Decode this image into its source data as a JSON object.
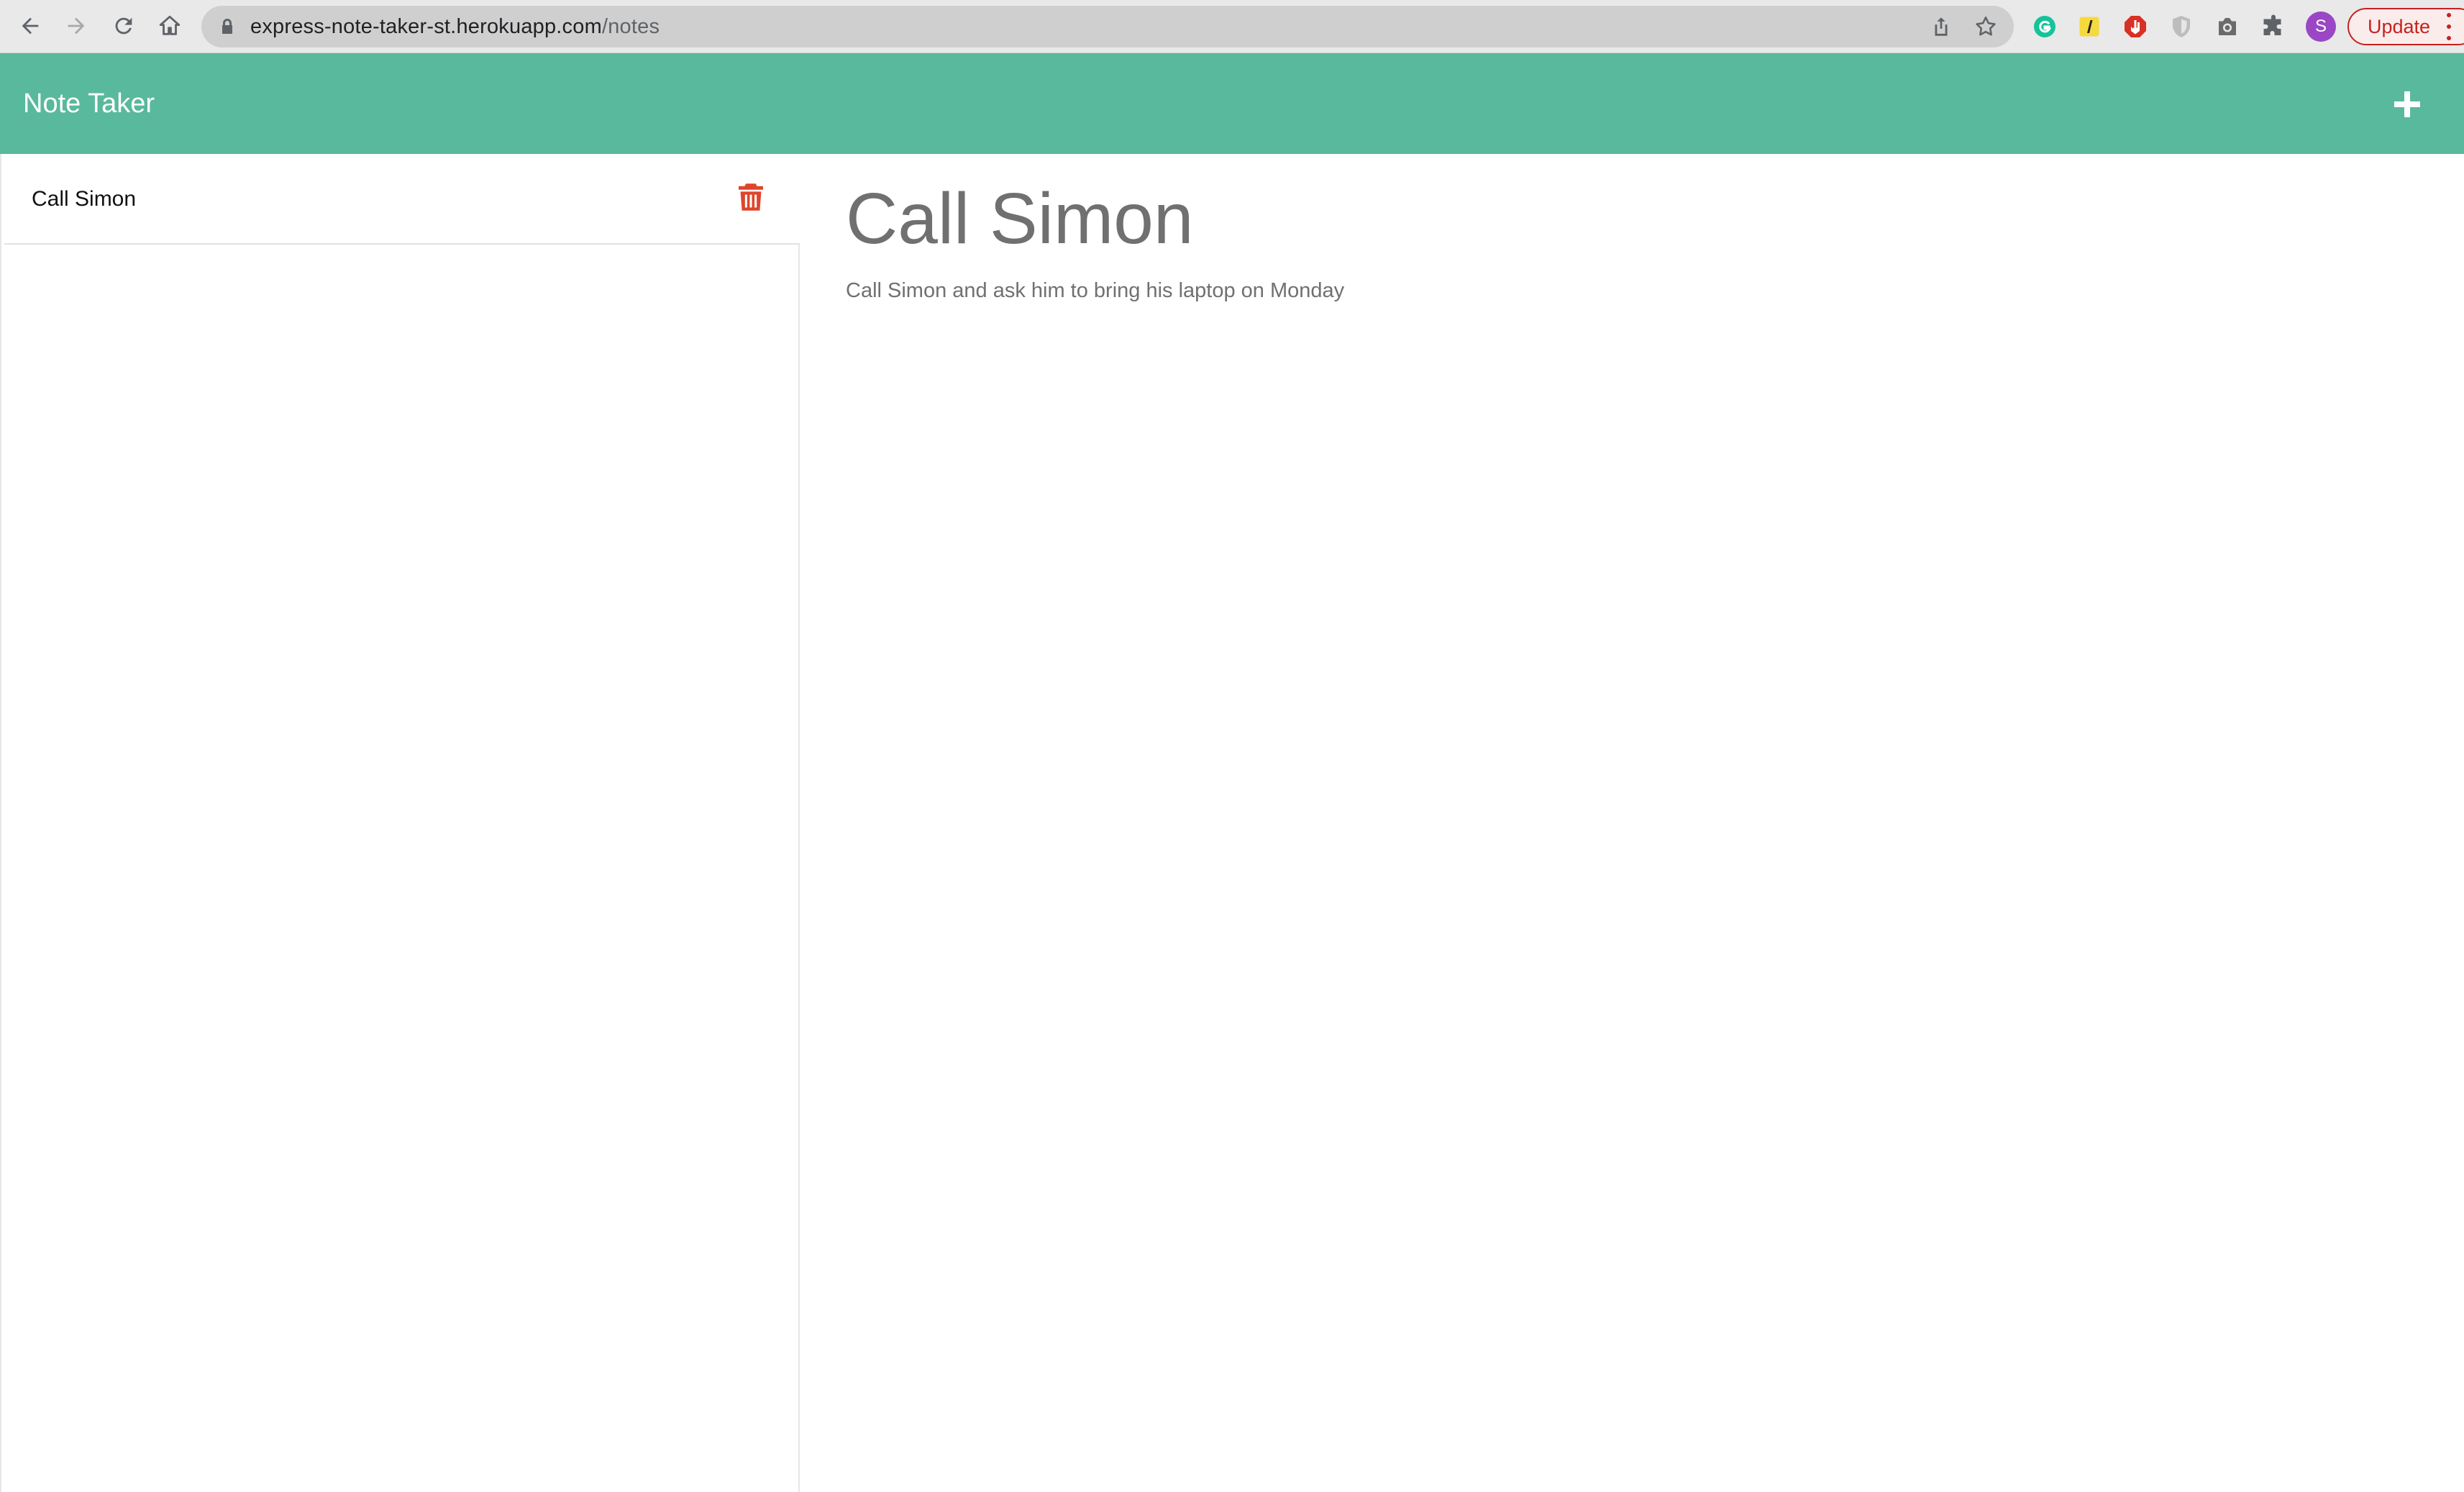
{
  "browser": {
    "url_host": "express-note-taker-st.herokuapp.com",
    "url_path": "/notes",
    "profile_initial": "S",
    "update_label": "Update",
    "icons": {
      "back": "back-arrow-icon",
      "forward": "forward-arrow-icon",
      "reload": "reload-icon",
      "home": "home-icon",
      "share": "share-icon",
      "bookmark": "star-icon",
      "extensions": [
        "grammarly-icon",
        "extension-yellow-icon",
        "adblock-icon",
        "shield-icon",
        "camera-icon",
        "puzzle-icon"
      ]
    }
  },
  "app": {
    "brand": "Note Taker",
    "new_note_icon": "plus-icon",
    "accent_color": "#59b99c",
    "delete_color": "#e0452b"
  },
  "notes_list": [
    {
      "title": "Call Simon"
    }
  ],
  "active_note": {
    "title": "Call Simon",
    "text": "Call Simon and ask him to bring his laptop on Monday"
  }
}
